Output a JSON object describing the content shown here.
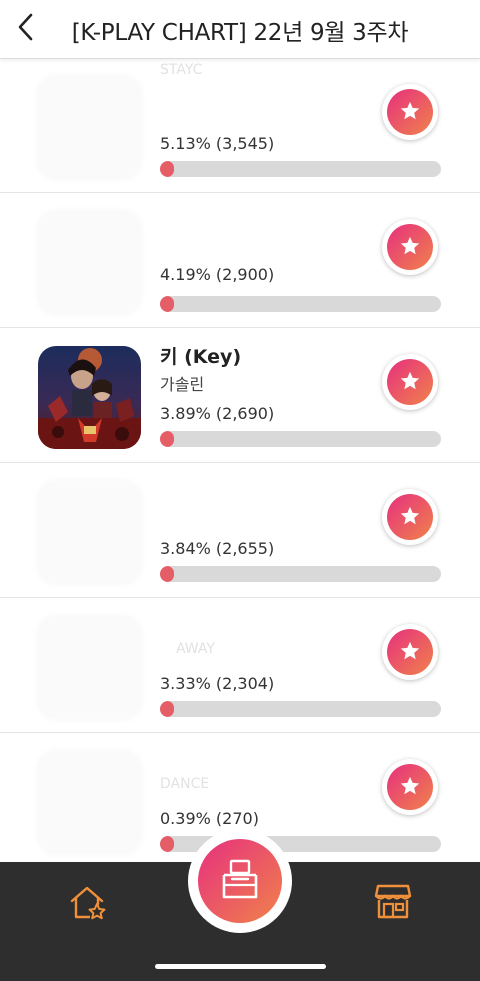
{
  "header": {
    "title": "[K-PLAY CHART] 22년 9월 3주차"
  },
  "colors": {
    "accent_start": "#e6307f",
    "accent_end": "#f0824a",
    "bar_fill": "#e55d66",
    "bar_track": "#d9d9d9",
    "nav_bg": "#2e2e2e"
  },
  "rows": [
    {
      "song": "",
      "artist": "STAYC",
      "percent_label": "5.13% (3,545)",
      "share": 0.0513
    },
    {
      "song": "",
      "artist": "",
      "percent_label": "4.19% (2,900)",
      "share": 0.0419
    },
    {
      "song": "키 (Key)",
      "artist": "가솔린",
      "percent_label": "3.89% (2,690)",
      "share": 0.0389
    },
    {
      "song": "",
      "artist": "",
      "percent_label": "3.84% (2,655)",
      "share": 0.0384
    },
    {
      "song": "",
      "artist": "AWAY",
      "percent_label": "3.33% (2,304)",
      "share": 0.0333
    },
    {
      "song": "",
      "artist": "DANCE",
      "percent_label": "0.39% (270)",
      "share": 0.0039
    }
  ],
  "icons": {
    "back": "chevron-left-icon",
    "vote": "star-icon",
    "home": "home-star-icon",
    "vote_box": "ballot-box-icon",
    "shop": "store-icon"
  }
}
